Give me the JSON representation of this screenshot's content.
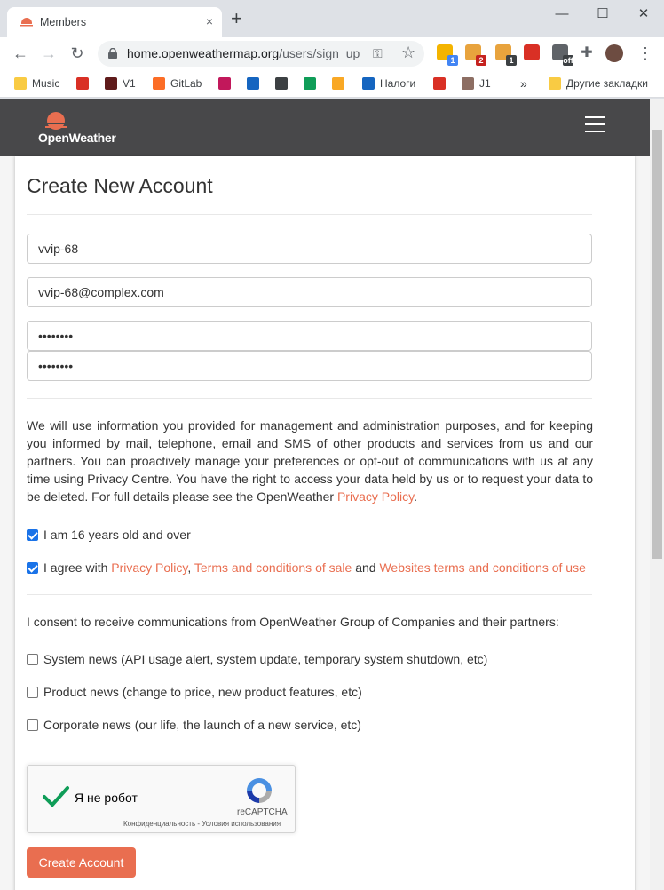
{
  "browser": {
    "tab_title": "Members",
    "tab_close": "×",
    "new_tab": "+",
    "window_controls": {
      "minimize": "—",
      "maximize": "☐",
      "close": "✕"
    },
    "url_host": "home.openweathermap.org",
    "url_path": "/users/sign_up",
    "extensions": [
      {
        "name": "ext-1",
        "badge": "1",
        "color": "#f4b400",
        "badge_color": "#4285f4"
      },
      {
        "name": "ext-2",
        "badge": "2",
        "color": "#e8a33d",
        "badge_color": "#c5221f"
      },
      {
        "name": "ext-3",
        "badge": "1",
        "color": "#e8a33d",
        "badge_color": "#3c4043"
      },
      {
        "name": "ext-4",
        "badge": "",
        "color": "#d93025",
        "badge_color": ""
      },
      {
        "name": "ext-5",
        "badge": "off",
        "color": "#5f6368",
        "badge_color": "#3c4043"
      }
    ],
    "bookmarks": [
      {
        "label": "Music",
        "icon": "folder-icon",
        "color": "#f9cb43"
      },
      {
        "label": "",
        "icon": "gauge-icon",
        "color": "#d93025"
      },
      {
        "label": "V1",
        "icon": "v1-icon",
        "color": "#5f1b1b"
      },
      {
        "label": "GitLab",
        "icon": "gitlab-icon",
        "color": "#fc6d26"
      },
      {
        "label": "",
        "icon": "rocket-icon",
        "color": "#c2185b"
      },
      {
        "label": "",
        "icon": "plane-icon",
        "color": "#1565c0"
      },
      {
        "label": "",
        "icon": "cross-icon",
        "color": "#3c4043"
      },
      {
        "label": "",
        "icon": "edge-icon",
        "color": "#0f9d58"
      },
      {
        "label": "",
        "icon": "at-icon",
        "color": "#f9a825"
      },
      {
        "label": "Налоги",
        "icon": "tax-icon",
        "color": "#1565c0"
      },
      {
        "label": "",
        "icon": "z-icon",
        "color": "#d93025"
      },
      {
        "label": "J1",
        "icon": "avatar-icon",
        "color": "#8d6e63"
      }
    ],
    "more_bookmarks": "»",
    "other_bookmarks": "Другие закладки"
  },
  "site": {
    "brand": "OpenWeather",
    "brand_color": "#e96e50",
    "header_color": "#48484a"
  },
  "form": {
    "title": "Create New Account",
    "username": "vvip-68",
    "email": "vvip-68@complex.com",
    "password": "••••••••",
    "password_confirm": "••••••••",
    "privacy_text": "We will use information you provided for management and administration purposes, and for keeping you informed by mail, telephone, email and SMS of other products and services from us and our partners. You can proactively manage your preferences or opt-out of communications with us at any time using Privacy Centre. You have the right to access your data held by us or to request your data to be deleted. For full details please see the OpenWeather ",
    "privacy_link": "Privacy Policy",
    "privacy_end": ".",
    "age_check": {
      "label": "I am 16 years old and over",
      "checked": true
    },
    "agree_check": {
      "prefix": "I agree with ",
      "link1": "Privacy Policy",
      "sep": ", ",
      "link2": "Terms and conditions of sale",
      "and": " and ",
      "link3": "Websites terms and conditions of use",
      "checked": true
    },
    "consent_text": "I consent to receive communications from OpenWeather Group of Companies and their partners:",
    "news": [
      {
        "label": "System news (API usage alert, system update, temporary system shutdown, etc)",
        "checked": false
      },
      {
        "label": "Product news (change to price, new product features, etc)",
        "checked": false
      },
      {
        "label": "Corporate news (our life, the launch of a new service, etc)",
        "checked": false
      }
    ],
    "recaptcha": {
      "label": "Я не робот",
      "brand": "reCAPTCHA",
      "links": "Конфиденциальность - Условия использования"
    },
    "submit_label": "Create Account",
    "accent_color": "#e96e50"
  }
}
